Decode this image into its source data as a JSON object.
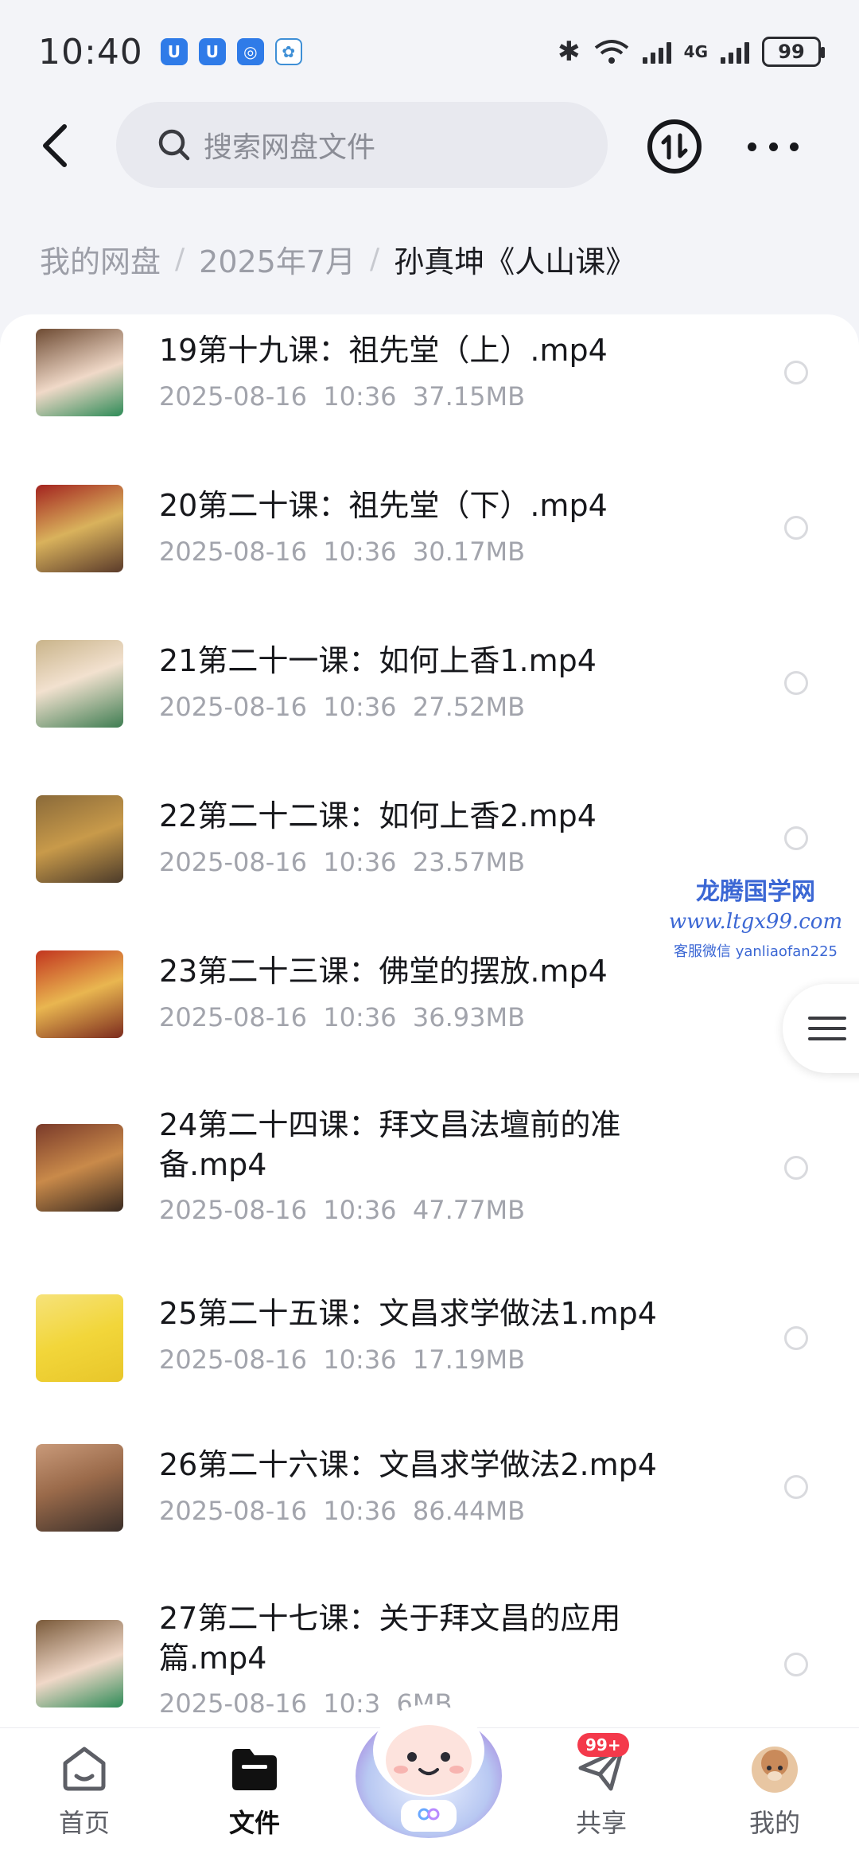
{
  "status_bar": {
    "time": "10:40",
    "battery": "99",
    "network": "4G"
  },
  "header": {
    "search_placeholder": "搜索网盘文件"
  },
  "breadcrumb": {
    "items": [
      "我的网盘",
      "2025年7月",
      "孙真坤《人山课》"
    ]
  },
  "files": [
    {
      "name": "19第十九课：祖先堂（上）.mp4",
      "date": "2025-08-16",
      "time": "10:36",
      "size": "37.15MB",
      "thumb_colors": [
        "#6e4b33",
        "#f0d9c8",
        "#2e8b57"
      ]
    },
    {
      "name": "20第二十课：祖先堂（下）.mp4",
      "date": "2025-08-16",
      "time": "10:36",
      "size": "30.17MB",
      "thumb_colors": [
        "#a3231f",
        "#d9b25c",
        "#5a3a2a"
      ]
    },
    {
      "name": "21第二十一课：如何上香1.mp4",
      "date": "2025-08-16",
      "time": "10:36",
      "size": "27.52MB",
      "thumb_colors": [
        "#c9b48a",
        "#f2e1cf",
        "#3f7d52"
      ]
    },
    {
      "name": "22第二十二课：如何上香2.mp4",
      "date": "2025-08-16",
      "time": "10:36",
      "size": "23.57MB",
      "thumb_colors": [
        "#8a6a3a",
        "#c89a4a",
        "#4c3b2a"
      ]
    },
    {
      "name": "23第二十三课：佛堂的摆放.mp4",
      "date": "2025-08-16",
      "time": "10:36",
      "size": "36.93MB",
      "thumb_colors": [
        "#c2351f",
        "#e9b650",
        "#7c2b1e"
      ]
    },
    {
      "name": "24第二十四课：拜文昌法壇前的准备.mp4",
      "date": "2025-08-16",
      "time": "10:36",
      "size": "47.77MB",
      "thumb_colors": [
        "#7a3a2a",
        "#c98a4a",
        "#3a2a20"
      ]
    },
    {
      "name": "25第二十五课：文昌求学做法1.mp4",
      "date": "2025-08-16",
      "time": "10:36",
      "size": "17.19MB",
      "thumb_colors": [
        "#f2d63a",
        "#e8c62a",
        "#f6e27a"
      ]
    },
    {
      "name": "26第二十六课：文昌求学做法2.mp4",
      "date": "2025-08-16",
      "time": "10:36",
      "size": "86.44MB",
      "thumb_colors": [
        "#9a6a4a",
        "#3a2f2a",
        "#c99a7a"
      ]
    },
    {
      "name": "27第二十七课：关于拜文昌的应用篇.mp4",
      "date": "2025-08-16",
      "time": "10:3",
      "size": "6MB",
      "thumb_colors": [
        "#7a5a3a",
        "#f0d8c8",
        "#2e8b57"
      ]
    }
  ],
  "watermark": {
    "title": "龙腾国学网",
    "url": "www.ltgx99.com",
    "note": "客服微信 yanliaofan225"
  },
  "bottom_nav": {
    "items": [
      {
        "label": "首页"
      },
      {
        "label": "文件"
      },
      {
        "label": "共享",
        "badge": "99+"
      },
      {
        "label": "我的"
      }
    ]
  }
}
